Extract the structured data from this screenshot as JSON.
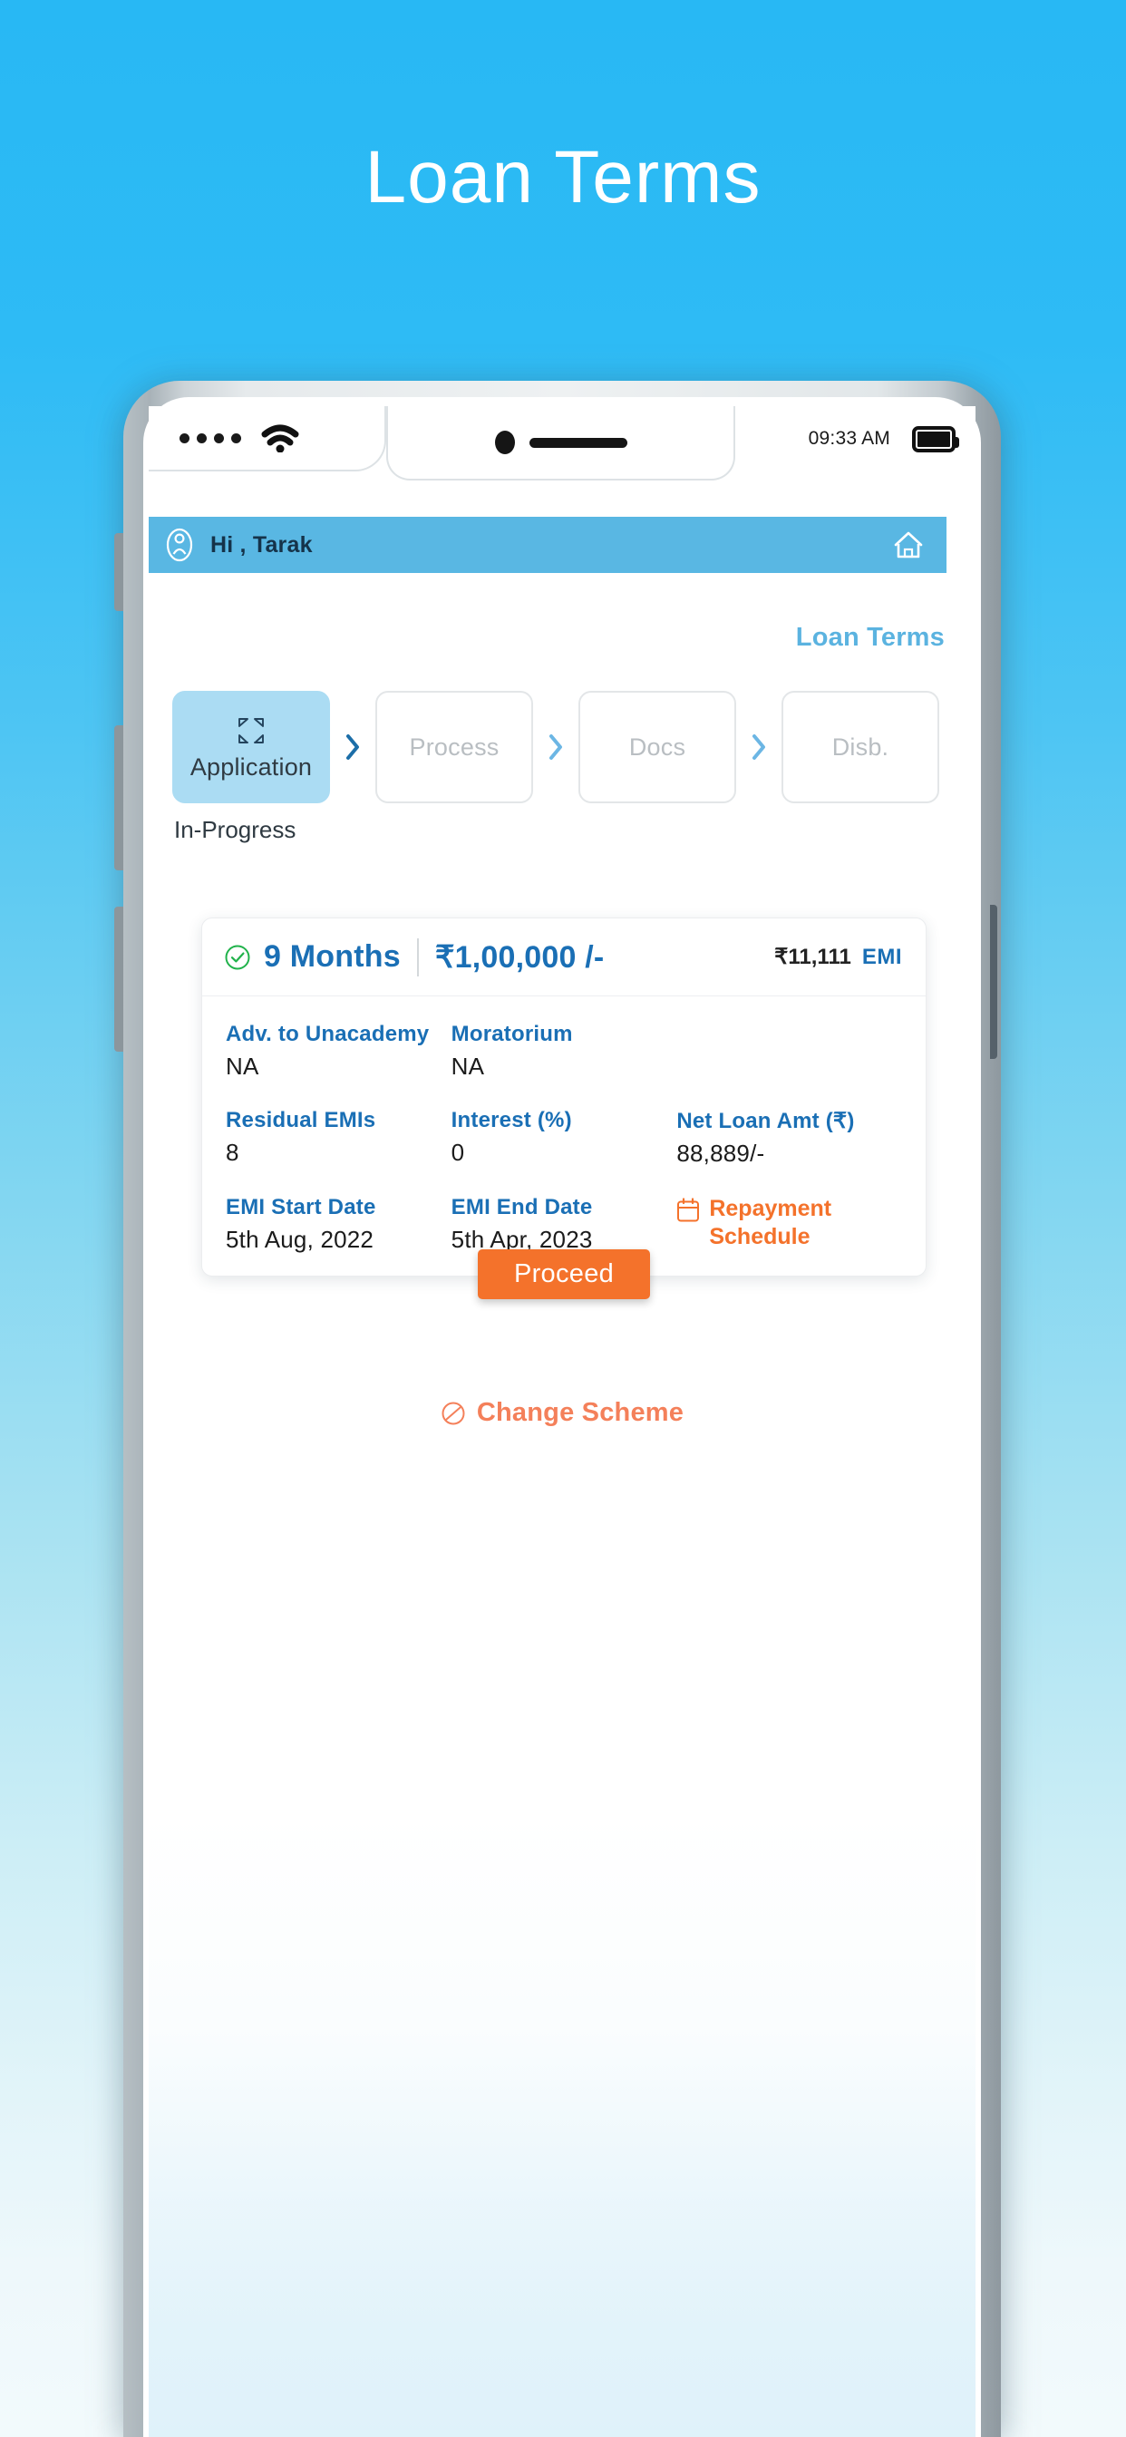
{
  "page": {
    "title": "Loan Terms",
    "accent_blue": "#29b6f0",
    "accent_orange": "#f4722b",
    "link_blue": "#1a6fb5"
  },
  "statusbar": {
    "time": "09:33 AM",
    "icons": [
      "signal-dots-icon",
      "wifi-icon",
      "camera-dot-icon",
      "speaker-bar-icon",
      "battery-icon"
    ]
  },
  "appbar": {
    "greeting": "Hi , Tarak",
    "avatar_icon": "user-avatar-icon",
    "home_icon": "home-icon"
  },
  "subheader": {
    "link_label": "Loan Terms"
  },
  "stepper": {
    "status": "In-Progress",
    "steps": [
      {
        "label": "Application",
        "icon": "expand-arrows-icon",
        "active": true
      },
      {
        "label": "Process",
        "icon": "",
        "active": false
      },
      {
        "label": "Docs",
        "icon": "",
        "active": false
      },
      {
        "label": "Disb.",
        "icon": "",
        "active": false
      }
    ]
  },
  "loan_card": {
    "check_icon": "circle-check-icon",
    "tenure": "9 Months",
    "amount": "₹1,00,000 /-",
    "emi_value": "₹11,111",
    "emi_label": "EMI",
    "fields": [
      [
        {
          "label": "Adv. to Unacademy",
          "value": "NA"
        },
        {
          "label": "Moratorium",
          "value": "NA"
        },
        {
          "label": "",
          "value": ""
        }
      ],
      [
        {
          "label": "Residual EMIs",
          "value": "8"
        },
        {
          "label": "Interest (%)",
          "value": "0"
        },
        {
          "label": "Net Loan Amt (₹)",
          "value": "88,889/-"
        }
      ],
      [
        {
          "label": "EMI Start Date",
          "value": "5th Aug, 2022"
        },
        {
          "label": "EMI End Date",
          "value": "5th Apr, 2023"
        },
        {
          "label": "",
          "value": ""
        }
      ]
    ],
    "repayment_link": "Repayment Schedule",
    "repayment_icon": "calendar-icon",
    "proceed_label": "Proceed"
  },
  "change_scheme": {
    "label": "Change Scheme",
    "icon": "circle-slash-icon"
  }
}
